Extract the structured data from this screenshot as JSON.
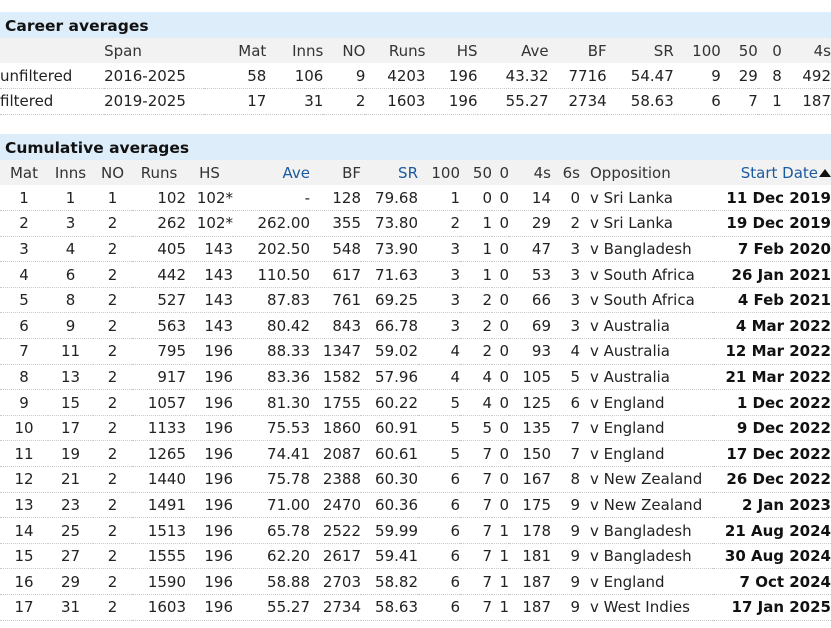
{
  "career": {
    "title": "Career averages",
    "headers": [
      "",
      "Span",
      "Mat",
      "Inns",
      "NO",
      "Runs",
      "HS",
      "Ave",
      "BF",
      "SR",
      "100",
      "50",
      "0",
      "4s"
    ],
    "rows": [
      [
        "unfiltered",
        "2016-2025",
        "58",
        "106",
        "9",
        "4203",
        "196",
        "43.32",
        "7716",
        "54.47",
        "9",
        "29",
        "8",
        "492"
      ],
      [
        "filtered",
        "2019-2025",
        "17",
        "31",
        "2",
        "1603",
        "196",
        "55.27",
        "2734",
        "58.63",
        "6",
        "7",
        "1",
        "187"
      ]
    ]
  },
  "cumulative": {
    "title": "Cumulative averages",
    "headers": [
      "Mat",
      "Inns",
      "NO",
      "Runs",
      "HS",
      "Ave",
      "BF",
      "SR",
      "100",
      "50",
      "0",
      "4s",
      "6s",
      "Opposition",
      "Start Date"
    ],
    "rows": [
      [
        "1",
        "1",
        "1",
        "102",
        "102*",
        "-",
        "128",
        "79.68",
        "1",
        "0",
        "0",
        "14",
        "0",
        "v Sri Lanka",
        "11 Dec 2019"
      ],
      [
        "2",
        "3",
        "2",
        "262",
        "102*",
        "262.00",
        "355",
        "73.80",
        "2",
        "1",
        "0",
        "29",
        "2",
        "v Sri Lanka",
        "19 Dec 2019"
      ],
      [
        "3",
        "4",
        "2",
        "405",
        "143",
        "202.50",
        "548",
        "73.90",
        "3",
        "1",
        "0",
        "47",
        "3",
        "v Bangladesh",
        "7 Feb 2020"
      ],
      [
        "4",
        "6",
        "2",
        "442",
        "143",
        "110.50",
        "617",
        "71.63",
        "3",
        "1",
        "0",
        "53",
        "3",
        "v South Africa",
        "26 Jan 2021"
      ],
      [
        "5",
        "8",
        "2",
        "527",
        "143",
        "87.83",
        "761",
        "69.25",
        "3",
        "2",
        "0",
        "66",
        "3",
        "v South Africa",
        "4 Feb 2021"
      ],
      [
        "6",
        "9",
        "2",
        "563",
        "143",
        "80.42",
        "843",
        "66.78",
        "3",
        "2",
        "0",
        "69",
        "3",
        "v Australia",
        "4 Mar 2022"
      ],
      [
        "7",
        "11",
        "2",
        "795",
        "196",
        "88.33",
        "1347",
        "59.02",
        "4",
        "2",
        "0",
        "93",
        "4",
        "v Australia",
        "12 Mar 2022"
      ],
      [
        "8",
        "13",
        "2",
        "917",
        "196",
        "83.36",
        "1582",
        "57.96",
        "4",
        "4",
        "0",
        "105",
        "5",
        "v Australia",
        "21 Mar 2022"
      ],
      [
        "9",
        "15",
        "2",
        "1057",
        "196",
        "81.30",
        "1755",
        "60.22",
        "5",
        "4",
        "0",
        "125",
        "6",
        "v England",
        "1 Dec 2022"
      ],
      [
        "10",
        "17",
        "2",
        "1133",
        "196",
        "75.53",
        "1860",
        "60.91",
        "5",
        "5",
        "0",
        "135",
        "7",
        "v England",
        "9 Dec 2022"
      ],
      [
        "11",
        "19",
        "2",
        "1265",
        "196",
        "74.41",
        "2087",
        "60.61",
        "5",
        "7",
        "0",
        "150",
        "7",
        "v England",
        "17 Dec 2022"
      ],
      [
        "12",
        "21",
        "2",
        "1440",
        "196",
        "75.78",
        "2388",
        "60.30",
        "6",
        "7",
        "0",
        "167",
        "8",
        "v New Zealand",
        "26 Dec 2022"
      ],
      [
        "13",
        "23",
        "2",
        "1491",
        "196",
        "71.00",
        "2470",
        "60.36",
        "6",
        "7",
        "0",
        "175",
        "9",
        "v New Zealand",
        "2 Jan 2023"
      ],
      [
        "14",
        "25",
        "2",
        "1513",
        "196",
        "65.78",
        "2522",
        "59.99",
        "6",
        "7",
        "1",
        "178",
        "9",
        "v Bangladesh",
        "21 Aug 2024"
      ],
      [
        "15",
        "27",
        "2",
        "1555",
        "196",
        "62.20",
        "2617",
        "59.41",
        "6",
        "7",
        "1",
        "181",
        "9",
        "v Bangladesh",
        "30 Aug 2024"
      ],
      [
        "16",
        "29",
        "2",
        "1590",
        "196",
        "58.88",
        "2703",
        "58.82",
        "6",
        "7",
        "1",
        "187",
        "9",
        "v England",
        "7 Oct 2024"
      ],
      [
        "17",
        "31",
        "2",
        "1603",
        "196",
        "55.27",
        "2734",
        "58.63",
        "6",
        "7",
        "1",
        "187",
        "9",
        "v West Indies",
        "17 Jan 2025"
      ]
    ]
  },
  "colors": {
    "header_band": "#ddeefa",
    "sortable_link": "#1a5a9e",
    "column_header_bg": "#f2f2f2"
  },
  "icons": {
    "sort": "sort-ascending-arrow-icon"
  }
}
